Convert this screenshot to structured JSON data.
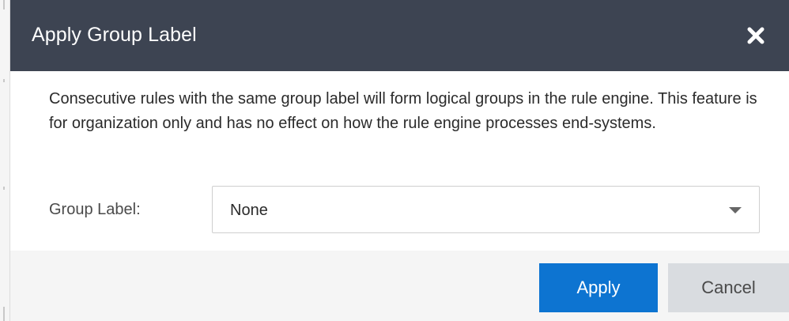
{
  "dialog": {
    "title": "Apply Group Label",
    "close_icon": "close-icon",
    "description": "Consecutive rules with the same group label will form logical groups in the rule engine. This feature is for organization only and has no effect on how the rule engine processes end-systems.",
    "group_label": {
      "label": "Group Label:",
      "selected_value": "None",
      "caret_icon": "caret-down-icon"
    },
    "buttons": {
      "apply_label": "Apply",
      "cancel_label": "Cancel"
    },
    "colors": {
      "header_bg": "#3d4452",
      "primary_button": "#0d74d1",
      "secondary_button": "#d9dce0",
      "footer_bg": "#f5f5f5"
    }
  }
}
